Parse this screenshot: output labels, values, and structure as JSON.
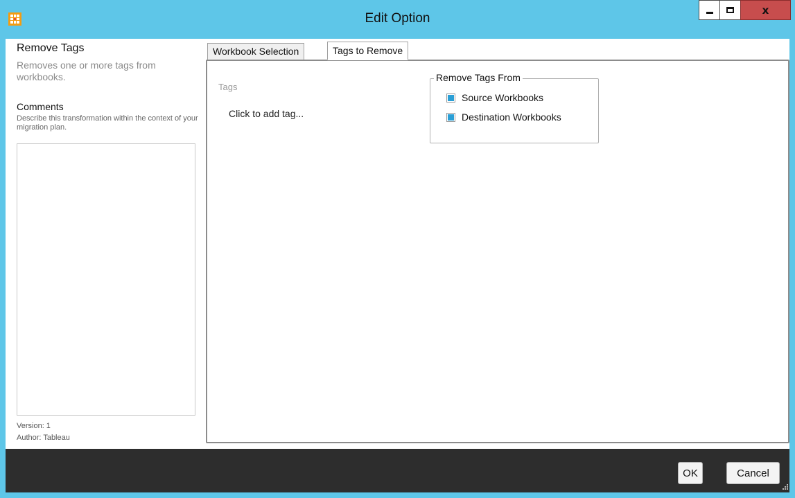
{
  "window": {
    "title": "Edit Option",
    "close_glyph": "x",
    "accent_color": "#5ec6e8",
    "icons": [
      "app-icon",
      "minimize-icon",
      "maximize-icon",
      "close-icon"
    ]
  },
  "operation": {
    "title": "Remove Tags",
    "description": "Removes one or more tags from workbooks.",
    "comments_label": "Comments",
    "comments_hint": "Describe this transformation within the context of your migration plan.",
    "comments_value": "",
    "version": "Version:  1",
    "author": "Author:  Tableau"
  },
  "tabs": [
    {
      "label": "Workbook Selection",
      "selected": false
    },
    {
      "label": "Tags to Remove",
      "selected": true
    }
  ],
  "tags_panel": {
    "tags_label": "Tags",
    "add_tag_placeholder": "Click to add tag...",
    "remove_from": {
      "title": "Remove Tags From",
      "options": [
        {
          "label": "Source Workbooks",
          "checked": true
        },
        {
          "label": "Destination Workbooks",
          "checked": true
        }
      ],
      "check_color": "#2a9fd6"
    }
  },
  "footer": {
    "ok_label": "OK",
    "cancel_label": "Cancel"
  }
}
